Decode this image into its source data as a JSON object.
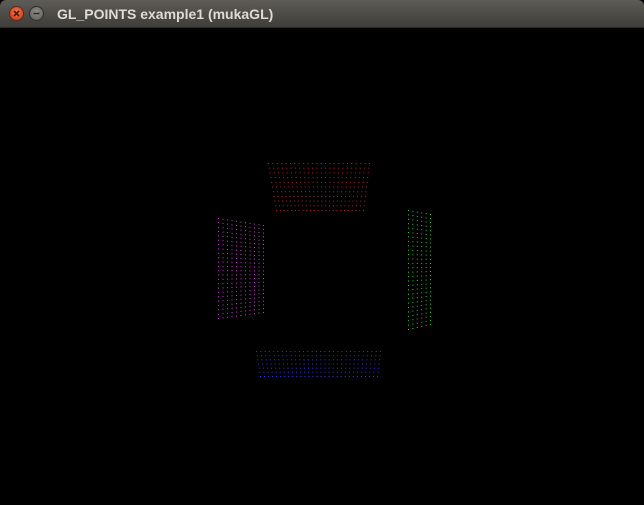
{
  "window": {
    "title": "GL_POINTS example1 (mukaGL)"
  },
  "titlebar_buttons": [
    {
      "name": "close",
      "icon": "close-icon"
    },
    {
      "name": "minimize",
      "icon": "minimize-icon"
    }
  ],
  "scene": {
    "background": "#000000",
    "point_groups": [
      {
        "name": "top-face-points",
        "color": "#c0202a"
      },
      {
        "name": "left-face-points",
        "color": "#d23cd6"
      },
      {
        "name": "right-face-points",
        "color": "#2fd23a"
      },
      {
        "name": "bottom-face-points",
        "color": "#3535e6"
      }
    ]
  }
}
